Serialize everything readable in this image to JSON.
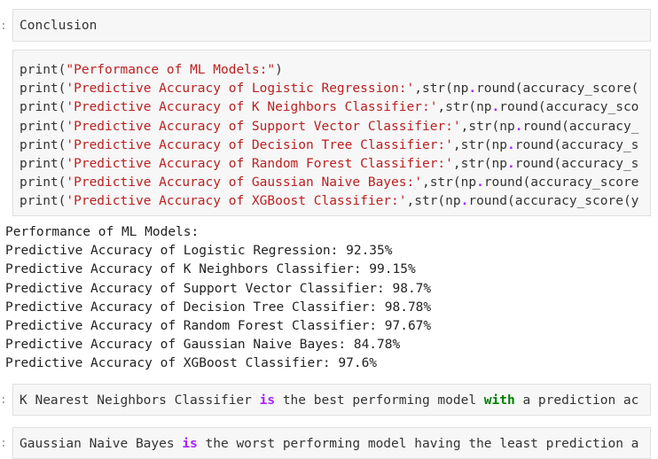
{
  "cells": {
    "heading_md": {
      "prompt": ":",
      "text": "Conclusion"
    },
    "code": {
      "lines": [
        {
          "fn": "print(",
          "str": "\"Performance of ML Models:\"",
          "rest": ")",
          "op": "",
          "tail": ""
        },
        {
          "fn": "print(",
          "str": "'Predictive Accuracy of Logistic Regression:'",
          "rest": ",str(np",
          "op": ".",
          "tail": "round(accuracy_score("
        },
        {
          "fn": "print(",
          "str": "'Predictive Accuracy of K Neighbors Classifier:'",
          "rest": ",str(np",
          "op": ".",
          "tail": "round(accuracy_sco"
        },
        {
          "fn": "print(",
          "str": "'Predictive Accuracy of Support Vector Classifier:'",
          "rest": ",str(np",
          "op": ".",
          "tail": "round(accuracy_"
        },
        {
          "fn": "print(",
          "str": "'Predictive Accuracy of Decision Tree Classifier:'",
          "rest": ",str(np",
          "op": ".",
          "tail": "round(accuracy_s"
        },
        {
          "fn": "print(",
          "str": "'Predictive Accuracy of Random Forest Classifier:'",
          "rest": ",str(np",
          "op": ".",
          "tail": "round(accuracy_s"
        },
        {
          "fn": "print(",
          "str": "'Predictive Accuracy of Gaussian Naive Bayes:'",
          "rest": ",str(np",
          "op": ".",
          "tail": "round(accuracy_score"
        },
        {
          "fn": "print(",
          "str": "'Predictive Accuracy of XGBoost Classifier:'",
          "rest": ",str(np",
          "op": ".",
          "tail": "round(accuracy_score(y"
        }
      ]
    },
    "output": {
      "lines": [
        "Performance of ML Models:",
        "Predictive Accuracy of Logistic Regression: 92.35%",
        "Predictive Accuracy of K Neighbors Classifier: 99.15%",
        "Predictive Accuracy of Support Vector Classifier: 98.7%",
        "Predictive Accuracy of Decision Tree Classifier: 98.78%",
        "Predictive Accuracy of Random Forest Classifier: 97.67%",
        "Predictive Accuracy of Gaussian Naive Bayes: 84.78%",
        "Predictive Accuracy of XGBoost Classifier: 97.6%"
      ]
    },
    "best_md": {
      "prompt": ":",
      "pre": "K Nearest Neighbors Classifier ",
      "kw1": "is",
      "mid": " the best performing model ",
      "kw2": "with",
      "post": " a prediction ac"
    },
    "worst_md": {
      "prompt": ":",
      "pre": "Gaussian Naive Bayes ",
      "kw1": "is",
      "post": " the worst performing model having the least prediction a"
    }
  }
}
